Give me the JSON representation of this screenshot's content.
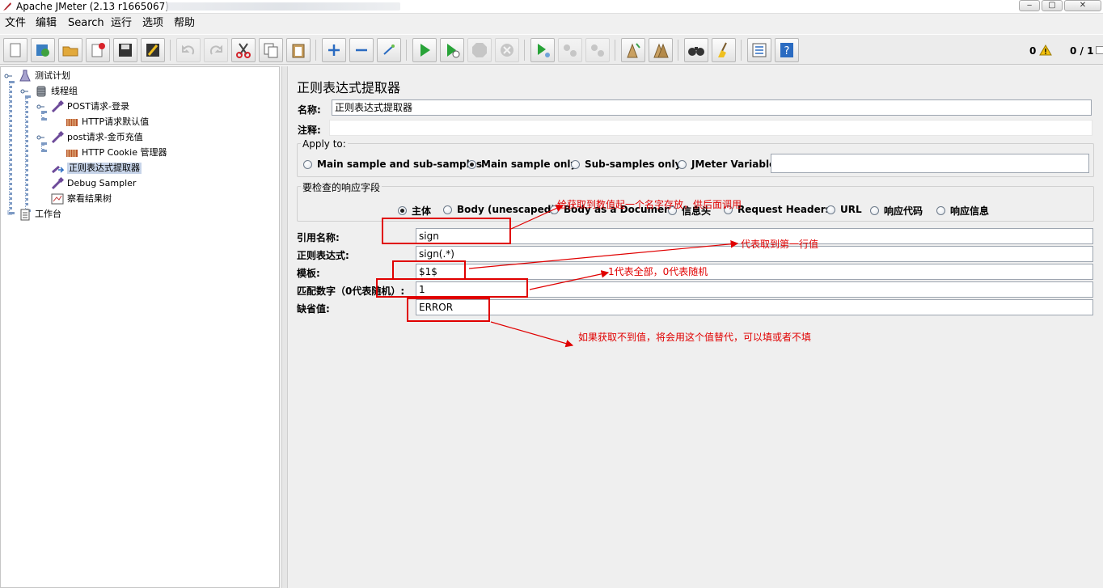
{
  "window": {
    "title": "Apache JMeter (2.13 r1665067)"
  },
  "menu": [
    "文件",
    "编辑",
    "Search",
    "运行",
    "选项",
    "帮助"
  ],
  "toolbar": {
    "errors_count": "0",
    "threads": "0 / 1"
  },
  "tree": [
    {
      "label": "测试计划"
    },
    {
      "label": "线程组"
    },
    {
      "label": "POST请求-登录"
    },
    {
      "label": "HTTP请求默认值"
    },
    {
      "label": "post请求-金币充值"
    },
    {
      "label": "HTTP Cookie 管理器"
    },
    {
      "label": "正则表达式提取器"
    },
    {
      "label": "Debug Sampler"
    },
    {
      "label": "察看结果树"
    },
    {
      "label": "工作台"
    }
  ],
  "panel": {
    "heading": "正则表达式提取器",
    "name_label": "名称:",
    "name_value": "正则表达式提取器",
    "comment_label": "注释:",
    "comment_value": "",
    "apply_to": {
      "title": "Apply to:",
      "options": [
        "Main sample and sub-samples",
        "Main sample only",
        "Sub-samples only",
        "JMeter Variable"
      ],
      "selected": "Main sample only",
      "variable_value": ""
    },
    "response_field": {
      "title": "要检查的响应字段",
      "options": [
        "主体",
        "Body (unescaped)",
        "Body as a Document",
        "信息头",
        "Request Headers",
        "URL",
        "响应代码",
        "响应信息"
      ],
      "selected": "主体"
    },
    "ref_name_label": "引用名称:",
    "ref_name_value": "sign",
    "regex_label": "正则表达式:",
    "regex_value": "sign(.*)",
    "template_label": "模板:",
    "template_value": "$1$",
    "match_no_label": "匹配数字（0代表随机）:",
    "match_no_value": "1",
    "default_label": "缺省值:",
    "default_value": "ERROR"
  },
  "annotations": {
    "ref_name_note": "给获取到数值起一个名字存放，供后面调用",
    "regex_note": "代表取到第一行值",
    "match_note": "1代表全部，0代表随机",
    "default_note": "如果获取不到值，将会用这个值替代，可以填或者不填",
    "color": "#e00000"
  }
}
